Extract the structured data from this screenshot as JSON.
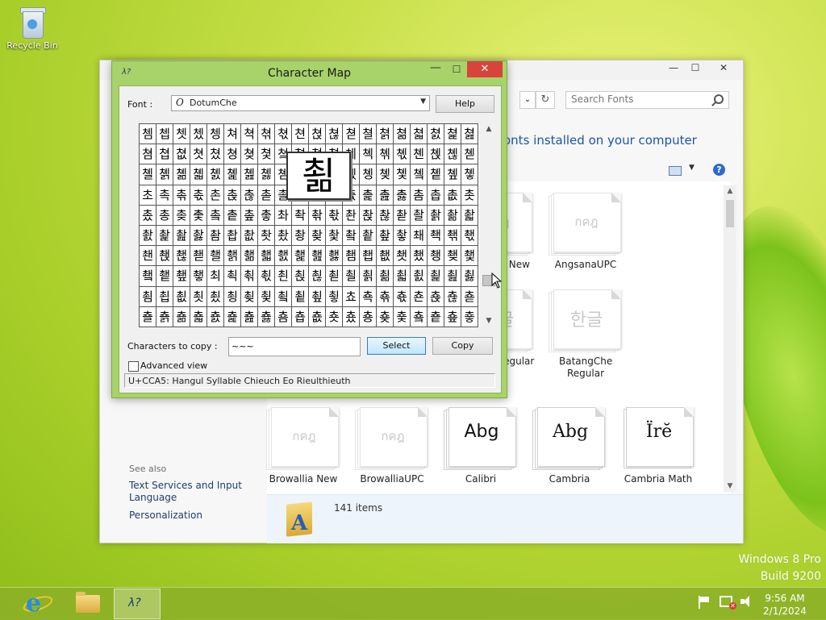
{
  "desktop": {
    "recycle_bin_label": "Recycle Bin"
  },
  "fonts_window": {
    "search_placeholder": "Search Fonts",
    "heading": "onts installed on your computer",
    "see_also": "See also",
    "links": [
      "Text Services and Input Language",
      "Personalization"
    ],
    "item_count": "141 items",
    "tiles": [
      {
        "sample": "",
        "label": "egular",
        "style": "cut"
      },
      {
        "sample": "กคฎ",
        "label": "Angsana New",
        "style": "faded"
      },
      {
        "sample": "กคฎ",
        "label": "AngsanaUPC",
        "style": "faded"
      },
      {
        "sample": "g",
        "label": "",
        "style": "cut"
      },
      {
        "sample": "한글",
        "label": "Batang Regular",
        "style": "faded2"
      },
      {
        "sample": "한글",
        "label": "BatangChe Regular",
        "style": "faded2"
      },
      {
        "sample": "กคฎ",
        "label": "Browallia New",
        "style": "faded"
      },
      {
        "sample": "กคฎ",
        "label": "BrowalliaUPC",
        "style": "faded"
      },
      {
        "sample": "Abg",
        "label": "Calibri",
        "style": "normal"
      },
      {
        "sample": "Abg",
        "label": "Cambria",
        "style": "normal"
      },
      {
        "sample": "Ïrĕ",
        "label": "Cambria Math",
        "style": "normal"
      }
    ]
  },
  "charmap": {
    "title": "Character Map",
    "font_label": "Font :",
    "font_name": "DotumChe",
    "help": "Help",
    "zoom_char": "쵦",
    "rows": [
      "쳄쳅쳇쳈쳉쳐쳑쳒쳓쳔쳕쳖쳗쳘쳙쳚쳛쳜쳝쳞",
      "쳠쳡쳢쳣쳤쳥쳦쳧쳨쳩쳪쳫쳬쳭쳮쳯쳰쳱쳲쳳",
      "쳴쳵쳶쳷쳸쳹쳺쳻쳼쳽쳾쳿촀촁촂촃촄촅촆촇",
      "초촉촊촋촌촍촎촏촐촑촒촓촔촕촖촗촘촙촚촛",
      "촜총촞촟촠촡촢촣촤촥촦촧촨촩촪촫촬촭촮촯",
      "촰촱촲촳촴촵촶촷촸촹촺촻촼촽촾촿쵀쵁쵂쵃",
      "쵄쵅쵆쵇쵈쵉쵊쵋쵌쵍쵎쵏쵐쵑쵒쵓쵔쵕쵖쵗",
      "쵘쵙쵚쵛최쵝쵞쵟쵠쵡쵢쵣쵤쵥쵦쵧쵨쵩쵪쵫",
      "쵬쵭쵮쵯쵰쵱쵲쵳쵴쵵쵶쵷쵸쵹쵺쵻쵼쵽쵾쵿",
      "춀춁춂춃춄춅춆춇춈춉춊춋춌춍춎춏춐춑춒춓"
    ],
    "copy_label": "Characters to copy :",
    "copy_value": "~~~",
    "select": "Select",
    "copy": "Copy",
    "advanced": "Advanced view",
    "status": "U+CCA5: Hangul Syllable Chieuch Eo Rieulthieuth"
  },
  "watermark": {
    "line1": "Windows 8 Pro",
    "line2": "Build 9200"
  },
  "clock": {
    "time": "9:56 AM",
    "date": "2/1/2024"
  }
}
